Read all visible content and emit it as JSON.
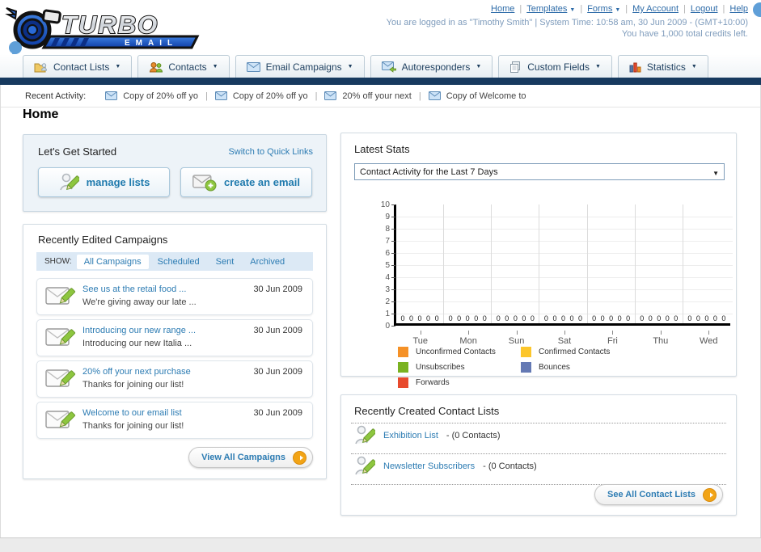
{
  "colors": {
    "navy_bar": "#173a5f",
    "link_blue": "#2d7cb3",
    "accent_orange": "#f2a416",
    "annotation_blue": "#5f9fd8"
  },
  "header": {
    "logo_title": "TURBO",
    "logo_subtitle": "EMAIL",
    "links": [
      {
        "label": "Home",
        "dropdown": false
      },
      {
        "label": "Templates",
        "dropdown": true
      },
      {
        "label": "Forms",
        "dropdown": true
      },
      {
        "label": "My Account",
        "dropdown": false
      },
      {
        "label": "Logout",
        "dropdown": false
      },
      {
        "label": "Help",
        "dropdown": false
      }
    ],
    "login_info": "You are logged in as \"Timothy Smith\" | System Time: 10:58 am, 30 Jun 2009 - (GMT+10:00)",
    "credits_info": "You have 1,000 total credits left."
  },
  "main_nav": {
    "tabs": [
      {
        "label": "Contact Lists",
        "icon": "folder-user-icon"
      },
      {
        "label": "Contacts",
        "icon": "users-icon"
      },
      {
        "label": "Email Campaigns",
        "icon": "envelope-icon"
      },
      {
        "label": "Autoresponders",
        "icon": "envelope-reply-icon"
      },
      {
        "label": "Custom Fields",
        "icon": "pages-icon"
      },
      {
        "label": "Statistics",
        "icon": "bar-chart-icon"
      }
    ]
  },
  "recent_activity": {
    "label": "Recent Activity:",
    "items": [
      "Copy of 20% off yo",
      "Copy of 20% off yo",
      "20% off your next",
      "Copy of Welcome to"
    ]
  },
  "page": {
    "title": "Home"
  },
  "get_started": {
    "heading": "Let's Get Started",
    "switch_link": "Switch to Quick Links",
    "buttons": [
      {
        "label": "manage lists",
        "icon": "user-pencil-icon"
      },
      {
        "label": "create an email",
        "icon": "envelope-plus-icon"
      }
    ]
  },
  "campaigns": {
    "heading": "Recently Edited Campaigns",
    "show_label": "SHOW:",
    "filters": [
      {
        "label": "All Campaigns",
        "active": true
      },
      {
        "label": "Scheduled",
        "active": false
      },
      {
        "label": "Sent",
        "active": false
      },
      {
        "label": "Archived",
        "active": false
      }
    ],
    "items": [
      {
        "title": "See us at the retail food ...",
        "subtitle": "We're giving away our late ...",
        "date": "30 Jun 2009"
      },
      {
        "title": "Introducing our new range ...",
        "subtitle": "Introducing our new Italia ...",
        "date": "30 Jun 2009"
      },
      {
        "title": "20% off your next purchase",
        "subtitle": "Thanks for joining our list!",
        "date": "30 Jun 2009"
      },
      {
        "title": "Welcome to our email list",
        "subtitle": "Thanks for joining our list!",
        "date": "30 Jun 2009"
      }
    ],
    "view_all_label": "View All Campaigns"
  },
  "stats": {
    "heading": "Latest Stats",
    "selected_option": "Contact Activity for the Last 7 Days"
  },
  "chart_data": {
    "type": "bar",
    "title": "Contact Activity for the Last 7 Days",
    "categories": [
      "Tue",
      "Mon",
      "Sun",
      "Sat",
      "Fri",
      "Thu",
      "Wed"
    ],
    "series": [
      {
        "name": "Unconfirmed Contacts",
        "color": "#f59127",
        "values": [
          0,
          0,
          0,
          0,
          0,
          0,
          0
        ]
      },
      {
        "name": "Confirmed Contacts",
        "color": "#fcc62c",
        "values": [
          0,
          0,
          0,
          0,
          0,
          0,
          0
        ]
      },
      {
        "name": "Unsubscribes",
        "color": "#7ab221",
        "values": [
          0,
          0,
          0,
          0,
          0,
          0,
          0
        ]
      },
      {
        "name": "Bounces",
        "color": "#6479b4",
        "values": [
          0,
          0,
          0,
          0,
          0,
          0,
          0
        ]
      },
      {
        "name": "Forwards",
        "color": "#e84a2d",
        "values": [
          0,
          0,
          0,
          0,
          0,
          0,
          0
        ]
      }
    ],
    "ylim": [
      0,
      10
    ],
    "yticks": [
      0,
      1,
      2,
      3,
      4,
      5,
      6,
      7,
      8,
      9,
      10
    ],
    "grid": true,
    "legend_position": "bottom"
  },
  "contact_lists": {
    "heading": "Recently Created Contact Lists",
    "items": [
      {
        "name": "Exhibition List",
        "suffix": "- (0 Contacts)"
      },
      {
        "name": "Newsletter Subscribers",
        "suffix": "- (0 Contacts)"
      }
    ],
    "see_all_label": "See All Contact Lists"
  }
}
